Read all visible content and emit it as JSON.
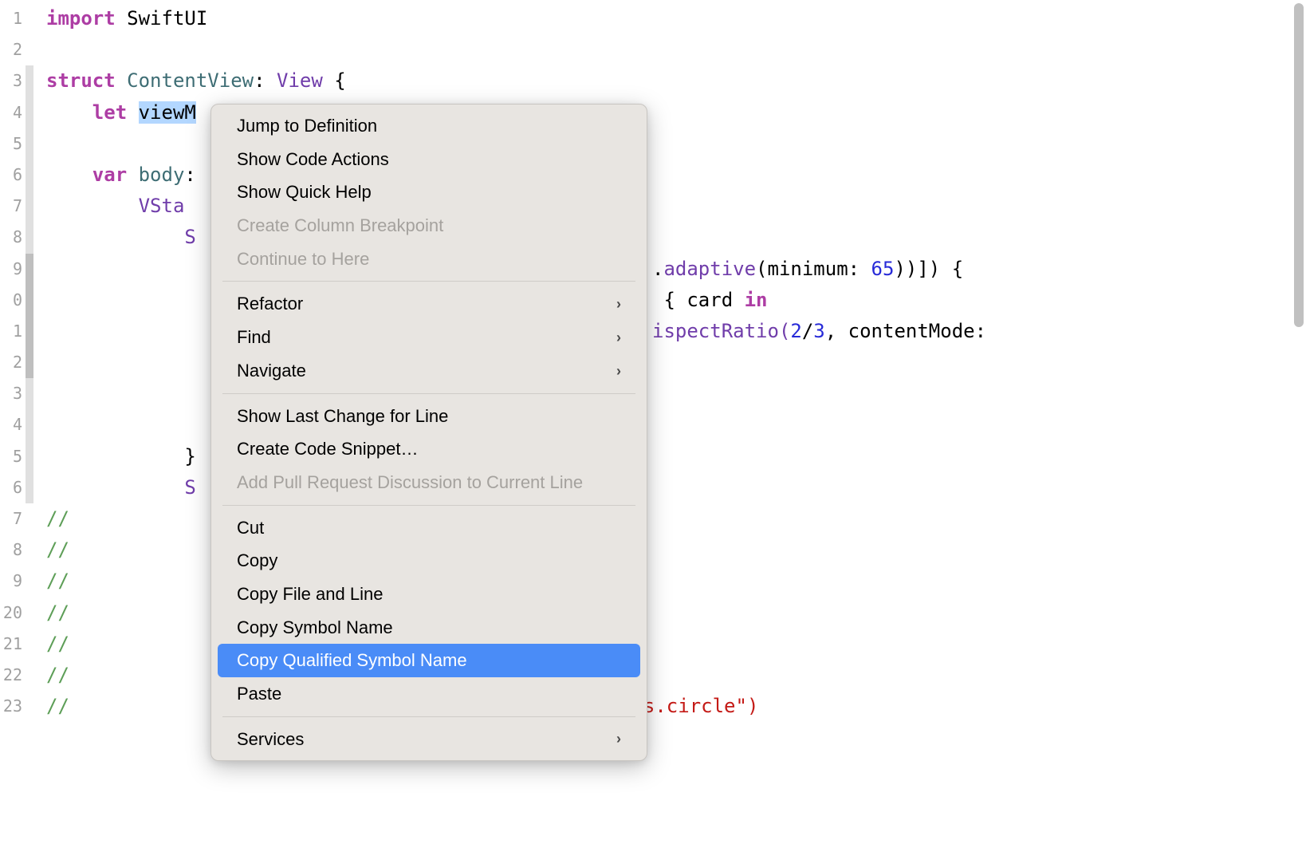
{
  "editor": {
    "gutter": [
      "1",
      "2",
      "3",
      "4",
      "5",
      "6",
      "7",
      "8",
      "9",
      "0",
      "1",
      "2",
      "3",
      "4",
      "5",
      "6",
      "7",
      "8",
      "9",
      "20",
      "21",
      "22",
      "23"
    ],
    "foldMarks": {
      "3": "light",
      "4": "light",
      "5": "light",
      "6": "light",
      "7": "light",
      "8": "light",
      "9": "dark",
      "10": "dark",
      "11": "dark",
      "12": "dark",
      "13": "light",
      "14": "light",
      "15": "light",
      "16": "light"
    },
    "code": {
      "l1_import": "import",
      "l1_swiftui": "SwiftUI",
      "l2": "",
      "l3_struct": "struct",
      "l3_name": "ContentView",
      "l3_colon": ":",
      "l3_view": "View",
      "l3_brace": " {",
      "l4_let": "let",
      "l4_viewm": "viewM",
      "l5": "",
      "l6_var": "var",
      "l6_body": "body",
      "l6_colon": ":",
      "l7_vsta": "VSta",
      "l8_s": "S",
      "l9_adaptive": ".adaptive(minimum: ",
      "l9_num": "65",
      "l9_tail": "))]) {",
      "l10_pre": " { card ",
      "l10_in": "in",
      "l11_pre": "ispectRatio(",
      "l11_num1": "2",
      "l11_slash": "/",
      "l11_num2": "3",
      "l11_tail": ", contentMode:",
      "l12": "",
      "l13": "",
      "l14": "",
      "l15_brace": "}",
      "l16_s": "S",
      "l17_c": "//",
      "l18_c": "//",
      "l19_c": "//",
      "l20_c": "//",
      "l21_c": "//",
      "l22_c": "//",
      "l23_c": "//",
      "l23_tail": "s.circle\")"
    }
  },
  "contextMenu": {
    "group1": [
      {
        "label": "Jump to Definition",
        "disabled": false,
        "submenu": false
      },
      {
        "label": "Show Code Actions",
        "disabled": false,
        "submenu": false
      },
      {
        "label": "Show Quick Help",
        "disabled": false,
        "submenu": false
      },
      {
        "label": "Create Column Breakpoint",
        "disabled": true,
        "submenu": false
      },
      {
        "label": "Continue to Here",
        "disabled": true,
        "submenu": false
      }
    ],
    "group2": [
      {
        "label": "Refactor",
        "disabled": false,
        "submenu": true
      },
      {
        "label": "Find",
        "disabled": false,
        "submenu": true
      },
      {
        "label": "Navigate",
        "disabled": false,
        "submenu": true
      }
    ],
    "group3": [
      {
        "label": "Show Last Change for Line",
        "disabled": false,
        "submenu": false
      },
      {
        "label": "Create Code Snippet…",
        "disabled": false,
        "submenu": false
      },
      {
        "label": "Add Pull Request Discussion to Current Line",
        "disabled": true,
        "submenu": false
      }
    ],
    "group4": [
      {
        "label": "Cut",
        "disabled": false,
        "submenu": false
      },
      {
        "label": "Copy",
        "disabled": false,
        "submenu": false
      },
      {
        "label": "Copy File and Line",
        "disabled": false,
        "submenu": false
      },
      {
        "label": "Copy Symbol Name",
        "disabled": false,
        "submenu": false
      },
      {
        "label": "Copy Qualified Symbol Name",
        "disabled": false,
        "submenu": false,
        "highlighted": true
      },
      {
        "label": "Paste",
        "disabled": false,
        "submenu": false
      }
    ],
    "group5": [
      {
        "label": "Services",
        "disabled": false,
        "submenu": true
      }
    ]
  }
}
